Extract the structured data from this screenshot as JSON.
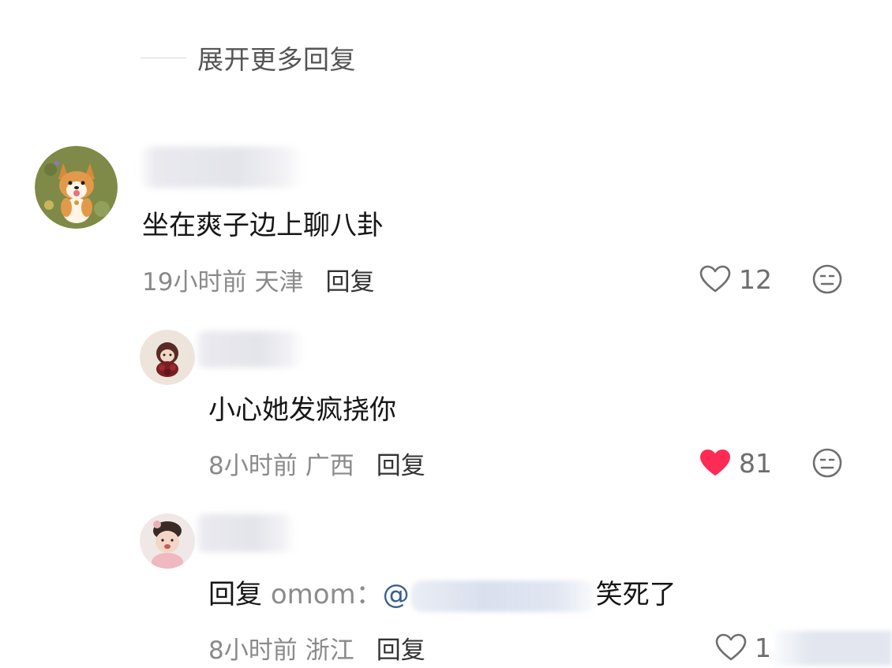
{
  "expand_more": {
    "label": "展开更多回复"
  },
  "comments": [
    {
      "avatar": "corgi-avatar",
      "text": "坐在爽子边上聊八卦",
      "time": "19小时前",
      "location": "天津",
      "reply_label": "回复",
      "likes": "12",
      "liked": false
    },
    {
      "avatar": "girl-doll-avatar",
      "text": "小心她发疯挠你",
      "time": "8小时前",
      "location": "广西",
      "reply_label": "回复",
      "likes": "81",
      "liked": true
    },
    {
      "avatar": "baby-avatar",
      "reply_prefix": "回复",
      "reply_to": "omom",
      "reply_colon": "：",
      "mention_at": "@",
      "text_suffix": "笑死了",
      "time": "8小时前",
      "location": "浙江",
      "reply_label": "回复",
      "likes": "1",
      "liked": false
    }
  ],
  "colors": {
    "like_active": "#fe2c55",
    "mention": "#3a5f8f",
    "meta_gray": "#8a8a8a"
  }
}
